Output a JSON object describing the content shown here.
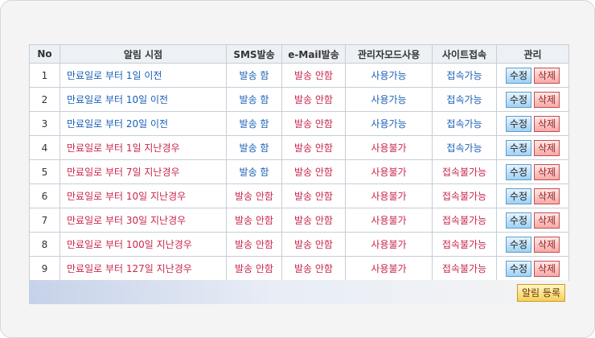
{
  "table": {
    "headers": {
      "no": "No",
      "alert_time": "알림 시점",
      "sms": "SMS발송",
      "email": "e-Mail발송",
      "admin_mode": "관리자모드사용",
      "site_access": "사이트접속",
      "manage": "관리"
    },
    "rows": [
      {
        "no": "1",
        "alert_time": "만료일로 부터 1일 이전",
        "sms": "발송 함",
        "email": "발송 안함",
        "admin_mode": "사용가능",
        "site_access": "접속가능",
        "edit": "수정",
        "delete": "삭제"
      },
      {
        "no": "2",
        "alert_time": "만료일로 부터 10일 이전",
        "sms": "발송 함",
        "email": "발송 안함",
        "admin_mode": "사용가능",
        "site_access": "접속가능",
        "edit": "수정",
        "delete": "삭제"
      },
      {
        "no": "3",
        "alert_time": "만료일로 부터 20일 이전",
        "sms": "발송 함",
        "email": "발송 안함",
        "admin_mode": "사용가능",
        "site_access": "접속가능",
        "edit": "수정",
        "delete": "삭제"
      },
      {
        "no": "4",
        "alert_time": "만료일로 부터 1일 지난경우",
        "sms": "발송 함",
        "email": "발송 안함",
        "admin_mode": "사용불가",
        "site_access": "접속가능",
        "edit": "수정",
        "delete": "삭제"
      },
      {
        "no": "5",
        "alert_time": "만료일로 부터 7일 지난경우",
        "sms": "발송 함",
        "email": "발송 안함",
        "admin_mode": "사용불가",
        "site_access": "접속불가능",
        "edit": "수정",
        "delete": "삭제"
      },
      {
        "no": "6",
        "alert_time": "만료일로 부터 10일 지난경우",
        "sms": "발송 안함",
        "email": "발송 안함",
        "admin_mode": "사용불가",
        "site_access": "접속불가능",
        "edit": "수정",
        "delete": "삭제"
      },
      {
        "no": "7",
        "alert_time": "만료일로 부터 30일 지난경우",
        "sms": "발송 안함",
        "email": "발송 안함",
        "admin_mode": "사용불가",
        "site_access": "접속불가능",
        "edit": "수정",
        "delete": "삭제"
      },
      {
        "no": "8",
        "alert_time": "만료일로 부터 100일 지난경우",
        "sms": "발송 안함",
        "email": "발송 안함",
        "admin_mode": "사용불가",
        "site_access": "접속불가능",
        "edit": "수정",
        "delete": "삭제"
      },
      {
        "no": "9",
        "alert_time": "만료일로 부터 127일 지난경우",
        "sms": "발송 안함",
        "email": "발송 안함",
        "admin_mode": "사용불가",
        "site_access": "접속불가능",
        "edit": "수정",
        "delete": "삭제"
      }
    ]
  },
  "footer": {
    "register_label": "알림 등록"
  },
  "colors": {
    "positive_text": "#1a5fb4",
    "negative_text": "#c8264e"
  }
}
